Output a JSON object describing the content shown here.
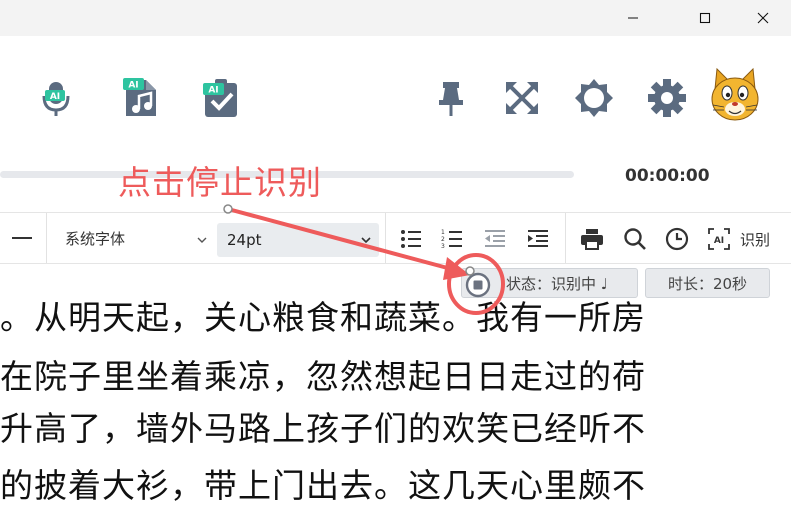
{
  "window": {
    "controls": [
      "minimize",
      "maximize",
      "close"
    ]
  },
  "toolbar": {
    "tools": [
      {
        "name": "voice-recognize",
        "icon": "microphone-icon",
        "badge": "AI"
      },
      {
        "name": "audio-recognize",
        "icon": "music-file-icon",
        "badge": "AI"
      },
      {
        "name": "ai-check",
        "icon": "clipboard-check-icon",
        "badge": "AI"
      }
    ],
    "right_icons": [
      "pin-icon",
      "fullscreen-icon",
      "brightness-icon",
      "settings-gear-icon",
      "cat-avatar-icon"
    ]
  },
  "player": {
    "time": "00:00:00"
  },
  "annotation": {
    "text": "点击停止识别",
    "color": "#ee5b5b"
  },
  "format": {
    "font_family_value": "系统字体",
    "font_size_value": "24pt",
    "recognize_label": "识别",
    "icons": [
      "bullet-list-icon",
      "numbered-list-icon",
      "outdent-icon",
      "indent-icon",
      "print-icon",
      "search-icon",
      "clock-icon",
      "ai-recognize-icon"
    ]
  },
  "status": {
    "state_label": "状态：识别中 ♩",
    "duration_label": "时长：20秒"
  },
  "document": {
    "lines": [
      "。从明天起，关心粮食和蔬菜。我有一所房",
      "在院子里坐着乘凉，忽然想起日日走过的荷",
      "升高了，墙外马路上孩子们的欢笑已经听不",
      "的披着大衫，带上门出去。这几天心里颇不"
    ]
  },
  "colors": {
    "accent_ai": "#2ec4a0",
    "icon_slate": "#5b6b80",
    "annotation_red": "#ee5b5b"
  }
}
